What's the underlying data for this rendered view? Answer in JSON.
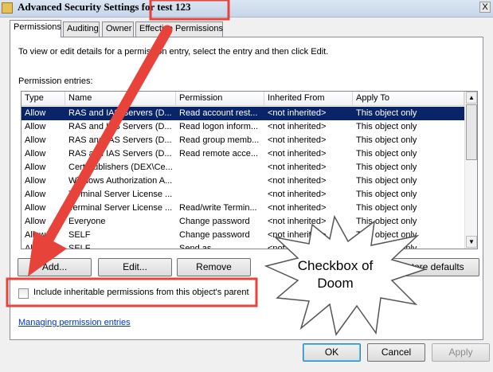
{
  "window": {
    "title": "Advanced Security Settings for test 123",
    "close_label": "X"
  },
  "tabs": [
    {
      "label": "Permissions",
      "active": true
    },
    {
      "label": "Auditing"
    },
    {
      "label": "Owner"
    },
    {
      "label": "Effective Permissions"
    }
  ],
  "permissions": {
    "instructions": "To view or edit details for a permission entry, select the entry and then click Edit.",
    "entries_label": "Permission entries:",
    "columns": [
      "Type",
      "Name",
      "Permission",
      "Inherited From",
      "Apply To"
    ],
    "rows": [
      [
        "Allow",
        "RAS and IAS Servers (D...",
        "Read account rest...",
        "<not inherited>",
        "This object only"
      ],
      [
        "Allow",
        "RAS and IAS Servers (D...",
        "Read logon inform...",
        "<not inherited>",
        "This object only"
      ],
      [
        "Allow",
        "RAS and IAS Servers (D...",
        "Read group memb...",
        "<not inherited>",
        "This object only"
      ],
      [
        "Allow",
        "RAS and IAS Servers (D...",
        "Read remote acce...",
        "<not inherited>",
        "This object only"
      ],
      [
        "Allow",
        "Cert Publishers (DEX\\Ce...",
        "",
        "<not inherited>",
        "This object only"
      ],
      [
        "Allow",
        "Windows Authorization A...",
        "",
        "<not inherited>",
        "This object only"
      ],
      [
        "Allow",
        "Terminal Server License ...",
        "",
        "<not inherited>",
        "This object only"
      ],
      [
        "Allow",
        "Terminal Server License ...",
        "Read/write Termin...",
        "<not inherited>",
        "This object only"
      ],
      [
        "Allow",
        "Everyone",
        "Change password",
        "<not inherited>",
        "This object only"
      ],
      [
        "Allow",
        "SELF",
        "Change password",
        "<not inherited>",
        "This object only"
      ],
      [
        "Allow",
        "SELF",
        "Send as",
        "<not inherited>",
        "This object only"
      ]
    ],
    "selected_row": 0,
    "buttons": {
      "add": "Add...",
      "edit": "Edit...",
      "remove": "Remove",
      "restore_defaults": "Restore defaults"
    },
    "include_inheritable_label": "Include inheritable permissions from this object's parent",
    "include_inheritable_checked": false,
    "help_link": "Managing permission entries"
  },
  "dialog_buttons": {
    "ok": "OK",
    "cancel": "Cancel",
    "apply": "Apply"
  },
  "annotation": {
    "callout_line1": "Checkbox of",
    "callout_line2": "Doom",
    "accent": "#e8433b"
  },
  "icons": {
    "title_icon": "folder-icon",
    "scroll_up": "▲",
    "scroll_down": "▼"
  }
}
